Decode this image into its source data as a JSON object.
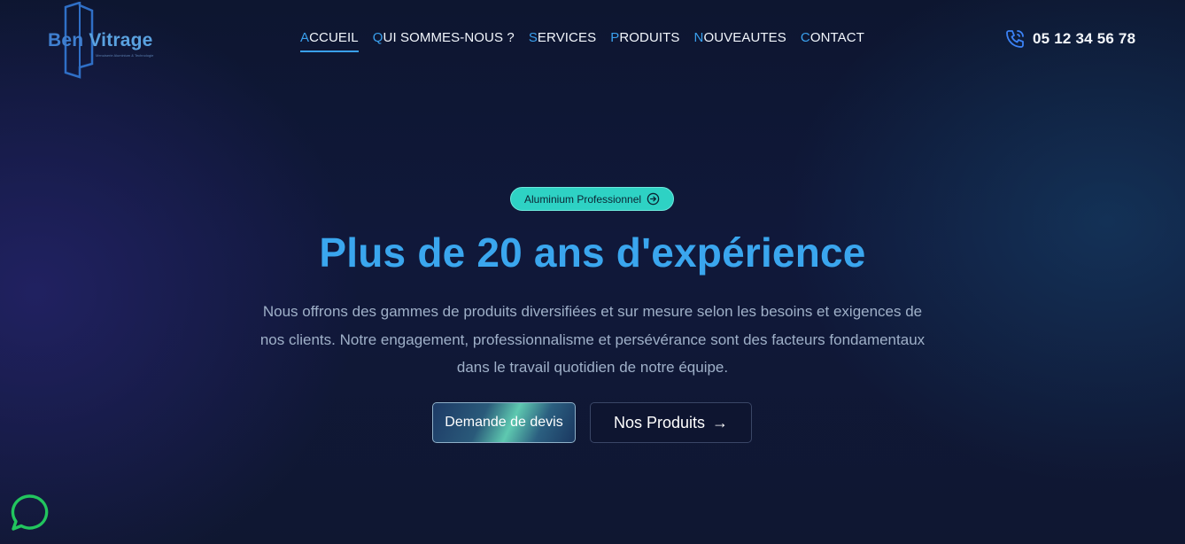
{
  "brand": {
    "name_part1": "Ben",
    "name_part2": "Vitrage",
    "tagline": "Menuiserie Aluminium & Technologie"
  },
  "nav": {
    "items": [
      {
        "first": "A",
        "rest": "CCUEIL",
        "active": true
      },
      {
        "first": "Q",
        "rest": "UI SOMMES-NOUS ?",
        "active": false
      },
      {
        "first": "S",
        "rest": "ERVICES",
        "active": false
      },
      {
        "first": "P",
        "rest": "RODUITS",
        "active": false
      },
      {
        "first": "N",
        "rest": "OUVEAUTES",
        "active": false
      },
      {
        "first": "C",
        "rest": "ONTACT",
        "active": false
      }
    ]
  },
  "header": {
    "phone_icon": "phone-icon",
    "phone_number": "05 12 34 56 78"
  },
  "hero": {
    "badge_label": "Aluminium Professionnel",
    "badge_icon": "arrow-circle-right-icon",
    "title": "Plus de 20 ans d'expérience",
    "description": "Nous offrons des gammes de produits diversifiées et sur mesure selon les besoins et exigences de nos clients. Notre engagement, professionnalisme et persévérance sont des facteurs fondamentaux dans le travail quotidien de notre équipe.",
    "primary_button": "Demande de devis",
    "secondary_button": "Nos Produits",
    "secondary_button_arrow": "→"
  },
  "chat": {
    "icon": "chat-bubble-icon"
  },
  "colors": {
    "accent": "#3aa6ee",
    "badge": "#2ed2c4",
    "chat": "#22c55e",
    "background": "#0f1731"
  }
}
